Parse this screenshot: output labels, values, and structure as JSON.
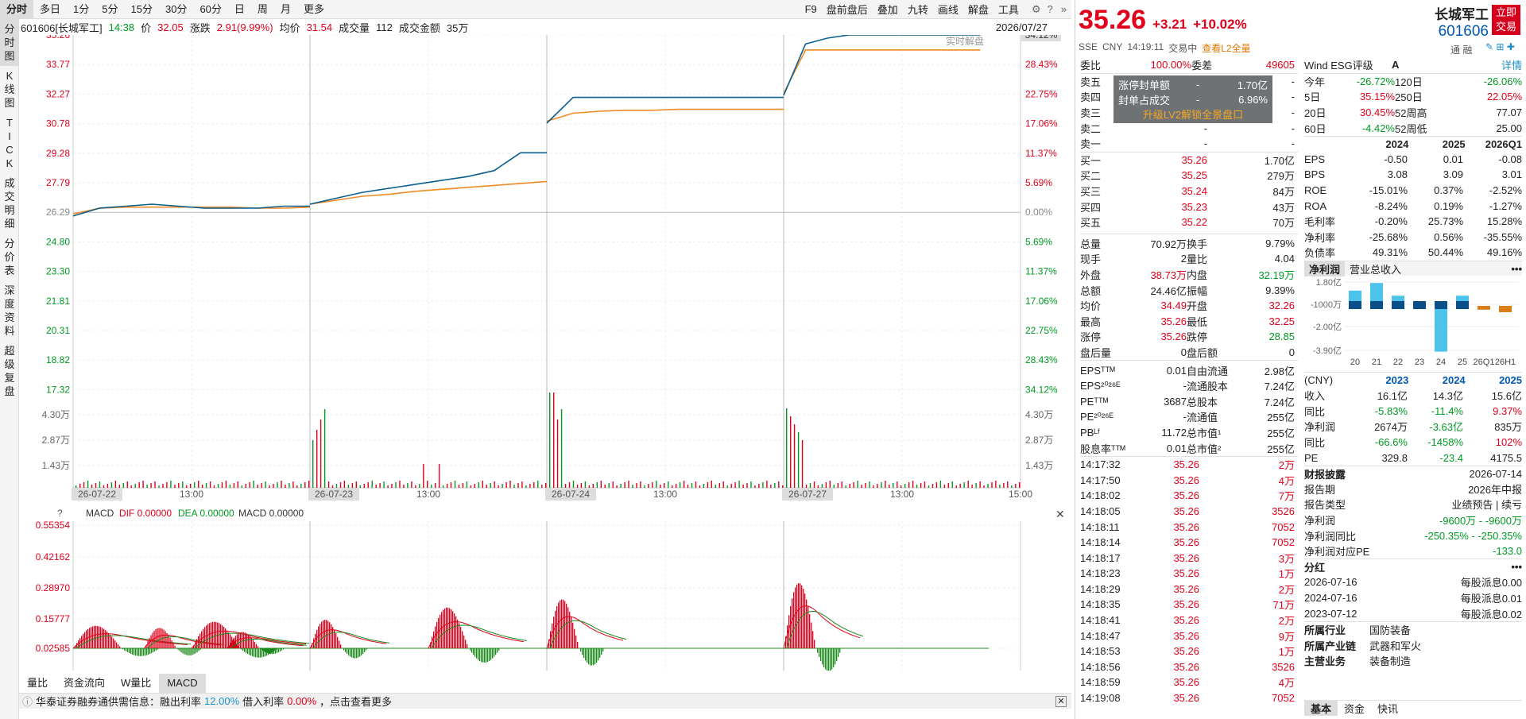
{
  "topbar": {
    "tabs": [
      "分时",
      "多日",
      "1分",
      "5分",
      "15分",
      "30分",
      "60分",
      "日",
      "周",
      "月",
      "更多"
    ],
    "active": 0,
    "tools": [
      "F9",
      "盘前盘后",
      "叠加",
      "九转",
      "画线",
      "解盘",
      "工具"
    ]
  },
  "leftnav": {
    "tabs": [
      "分时图",
      "K线图",
      "TICK",
      "成交明细",
      "分价表",
      "深度资料",
      "超级复盘"
    ]
  },
  "info": {
    "stock": "601606[长城军工]",
    "time": "14:38",
    "price_label": "价",
    "price": "32.05",
    "chg_label": "涨跌",
    "chg": "2.91(9.99%)",
    "avg_label": "均价",
    "avg": "31.54",
    "vol_label": "成交量",
    "vol": "112",
    "amt_label": "成交金额",
    "amt": "35万",
    "date": "2026/07/27",
    "realtime": "实时解盘"
  },
  "chart_data": {
    "type": "line",
    "price_axis": [
      "35.26",
      "33.77",
      "32.27",
      "30.78",
      "29.28",
      "27.79",
      "26.29",
      "24.80",
      "23.30",
      "21.81",
      "20.31",
      "18.82",
      "17.32"
    ],
    "pct_axis": [
      "34.12%",
      "28.43%",
      "22.75%",
      "17.06%",
      "11.37%",
      "5.69%",
      "0.00%",
      "5.69%",
      "11.37%",
      "17.06%",
      "22.75%",
      "28.43%",
      "34.12%"
    ],
    "vol_axis": [
      "4.30万",
      "2.87万",
      "1.43万"
    ],
    "x_labels": [
      "26-07-22",
      "13:00",
      "26-07-23",
      "13:00",
      "26-07-24",
      "13:00",
      "26-07-27",
      "13:00",
      "15:00"
    ],
    "price_days": [
      [
        26.1,
        26.5,
        26.6,
        26.7,
        26.6,
        26.5,
        26.5,
        26.5,
        26.6,
        26.6
      ],
      [
        26.7,
        27.0,
        27.3,
        27.5,
        27.7,
        27.9,
        28.1,
        28.4,
        29.3,
        29.3
      ],
      [
        30.8,
        32.1,
        32.1,
        32.1,
        32.1,
        32.1,
        32.1,
        32.1,
        32.1,
        32.1
      ],
      [
        32.2,
        34.8,
        35.1,
        35.26,
        35.26,
        35.26,
        35.26,
        35.26,
        35.26,
        35.26
      ]
    ],
    "avg_days": [
      [
        26.2,
        26.5,
        26.55,
        26.55,
        26.55,
        26.55,
        26.55,
        26.5,
        26.5,
        26.55
      ],
      [
        26.7,
        26.9,
        27.1,
        27.2,
        27.35,
        27.45,
        27.55,
        27.65,
        27.75,
        27.85
      ],
      [
        30.9,
        31.3,
        31.4,
        31.45,
        31.45,
        31.5,
        31.5,
        31.5,
        31.5,
        31.5
      ],
      [
        32.3,
        34.5,
        34.5,
        34.5,
        34.5,
        34.5,
        34.5,
        34.5,
        34.5,
        34.5
      ]
    ],
    "macd": {
      "label": "MACD",
      "dif_label": "DIF 0.00000",
      "dea_label": "DEA 0.00000",
      "macd_label": "MACD 0.00000",
      "axis": [
        "0.55354",
        "0.42162",
        "0.28970",
        "0.15777",
        "0.02585"
      ]
    }
  },
  "bottom_tabs": [
    "量比",
    "资金流向",
    "W量比",
    "MACD"
  ],
  "notice": {
    "text1": "华泰证券融券通供需信息：融出利率",
    "rate1": "12.00%",
    "text2": "借入利率",
    "rate2": "0.00%",
    "text3": "，点击查看更多"
  },
  "quote": {
    "price": "35.26",
    "chg": "+3.21",
    "pct": "+10.02%",
    "name": "长城军工",
    "code": "601606",
    "trade_btn": "立即交易",
    "exch": "SSE",
    "ccy": "CNY",
    "time": "14:19:11",
    "status": "交易中",
    "l2": "查看L2全量",
    "webi_label": "委比",
    "webi": "100.00%",
    "weicha_label": "委差",
    "weicha": "49605",
    "sell": [
      [
        "卖五",
        "-",
        "-"
      ],
      [
        "卖四",
        "-",
        "-"
      ],
      [
        "卖三",
        "-",
        "-"
      ],
      [
        "卖二",
        "-",
        "-"
      ],
      [
        "卖一",
        "-",
        "-"
      ]
    ],
    "overlay": [
      [
        "涨停封单额",
        "-",
        "1.70亿"
      ],
      [
        "封单占成交",
        "-",
        "6.96%"
      ]
    ],
    "overlay_link": "升级LV2解锁全景盘口",
    "buy": [
      [
        "买一",
        "35.26",
        "1.70亿"
      ],
      [
        "买二",
        "35.25",
        "279万"
      ],
      [
        "买三",
        "35.24",
        "84万"
      ],
      [
        "买四",
        "35.23",
        "43万"
      ],
      [
        "买五",
        "35.22",
        "70万"
      ]
    ],
    "stats": [
      [
        "总量",
        "70.92万",
        "换手",
        "9.79%"
      ],
      [
        "现手",
        "2",
        "量比",
        "4.04"
      ],
      [
        "外盘",
        "38.73万",
        "内盘",
        "32.19万"
      ],
      [
        "总额",
        "24.46亿",
        "振幅",
        "9.39%"
      ],
      [
        "均价",
        "34.49",
        "开盘",
        "32.26"
      ],
      [
        "最高",
        "35.26",
        "最低",
        "32.25"
      ],
      [
        "涨停",
        "35.26",
        "跌停",
        "28.85"
      ],
      [
        "盘后量",
        "0",
        "盘后额",
        "0"
      ]
    ],
    "fund": [
      [
        "EPSᵀᵀᴹ",
        "0.01",
        "自由流通",
        "2.98亿"
      ],
      [
        "EPS²⁰²⁶ᴱ",
        "-",
        "流通股本",
        "7.24亿"
      ],
      [
        "PEᵀᵀᴹ",
        "3687",
        "总股本",
        "7.24亿"
      ],
      [
        "PE²⁰²⁶ᴱ",
        "-",
        "流通值",
        "255亿"
      ],
      [
        "PBᴸᶠ",
        "11.72",
        "总市值¹",
        "255亿"
      ],
      [
        "股息率ᵀᵀᴹ",
        "0.01",
        "总市值²",
        "255亿"
      ]
    ],
    "ticks": [
      [
        "14:17:32",
        "35.26",
        "2万"
      ],
      [
        "14:17:50",
        "35.26",
        "4万"
      ],
      [
        "14:18:02",
        "35.26",
        "7万"
      ],
      [
        "14:18:05",
        "35.26",
        "3526"
      ],
      [
        "14:18:11",
        "35.26",
        "7052"
      ],
      [
        "14:18:14",
        "35.26",
        "7052"
      ],
      [
        "14:18:17",
        "35.26",
        "3万"
      ],
      [
        "14:18:23",
        "35.26",
        "1万"
      ],
      [
        "14:18:29",
        "35.26",
        "2万"
      ],
      [
        "14:18:35",
        "35.26",
        "71万"
      ],
      [
        "14:18:41",
        "35.26",
        "2万"
      ],
      [
        "14:18:47",
        "35.26",
        "9万"
      ],
      [
        "14:18:53",
        "35.26",
        "1万"
      ],
      [
        "14:18:56",
        "35.26",
        "3526"
      ],
      [
        "14:18:59",
        "35.26",
        "4万"
      ],
      [
        "14:19:08",
        "35.26",
        "7052"
      ]
    ]
  },
  "fpanel": {
    "esg_label": "Wind ESG评级",
    "esg": "A",
    "detail": "详情",
    "icons_label": "通 融",
    "perf": [
      [
        "今年",
        "-26.72%",
        "120日",
        "-26.06%"
      ],
      [
        "5日",
        "35.15%",
        "250日",
        "22.05%"
      ],
      [
        "20日",
        "30.45%",
        "52周高",
        "77.07"
      ],
      [
        "60日",
        "-4.42%",
        "52周低",
        "25.00"
      ]
    ],
    "years": [
      "2024",
      "2025",
      "2026Q1"
    ],
    "ratios": [
      [
        "EPS",
        "-0.50",
        "0.01",
        "-0.08"
      ],
      [
        "BPS",
        "3.08",
        "3.09",
        "3.01"
      ],
      [
        "ROE",
        "-15.01%",
        "0.37%",
        "-2.52%"
      ],
      [
        "ROA",
        "-8.24%",
        "0.19%",
        "-1.27%"
      ],
      [
        "毛利率",
        "-0.20%",
        "25.73%",
        "15.28%"
      ],
      [
        "净利率",
        "-25.68%",
        "0.56%",
        "-35.55%"
      ],
      [
        "负债率",
        "49.31%",
        "50.44%",
        "49.16%"
      ]
    ],
    "np_tabs": [
      "净利润",
      "营业总收入"
    ],
    "np_axis": [
      "1.80亿",
      "-1000万",
      "-2.00亿",
      "-3.90亿"
    ],
    "np_labels": [
      "20",
      "21",
      "22",
      "23",
      "24",
      "25",
      "26Q1",
      "26H1"
    ],
    "np_values": [
      1.2,
      1.8,
      0.8,
      0.3,
      -3.6,
      0.8,
      -0.3,
      -0.5
    ],
    "fin_hdr": [
      "(CNY)",
      "2023",
      "2024",
      "2025"
    ],
    "fin": [
      [
        "收入",
        "16.1亿",
        "14.3亿",
        "15.6亿"
      ],
      [
        "同比",
        "-5.83%",
        "-11.4%",
        "9.37%"
      ],
      [
        "净利润",
        "2674万",
        "-3.63亿",
        "835万"
      ],
      [
        "同比",
        "-66.6%",
        "-1458%",
        "102%"
      ],
      [
        "PE",
        "329.8",
        "-23.4",
        "4175.5"
      ]
    ],
    "report_label": "财报披露",
    "report_date": "2026-07-14",
    "report": [
      [
        "报告期",
        "2026年中报"
      ],
      [
        "报告类型",
        "业绩预告 | 续亏"
      ],
      [
        "净利润",
        "-9600万 - -9600万"
      ],
      [
        "净利润同比",
        "-250.35% - -250.35%"
      ],
      [
        "净利润对应PE",
        "-133.0"
      ]
    ],
    "div_label": "分红",
    "div": [
      [
        "2026-07-16",
        "每股派息0.00"
      ],
      [
        "2024-07-16",
        "每股派息0.01"
      ],
      [
        "2023-07-12",
        "每股派息0.02"
      ]
    ],
    "ind": [
      [
        "所属行业",
        "国防装备"
      ],
      [
        "所属产业链",
        "武器和军火"
      ],
      [
        "主营业务",
        "装备制造"
      ]
    ],
    "bottom_tabs": [
      "基本",
      "资金",
      "快讯"
    ]
  }
}
